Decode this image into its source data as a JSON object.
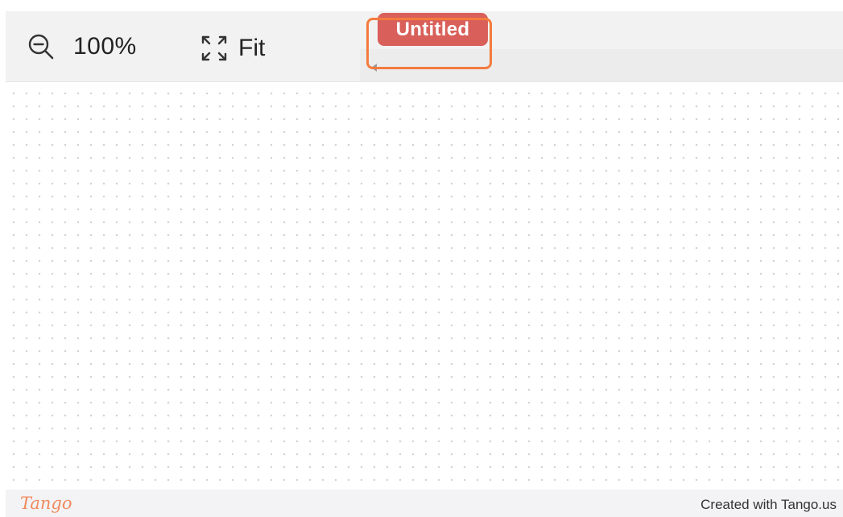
{
  "toolbar": {
    "zoom_label": "100%",
    "zoom_icon": "zoom-out-icon",
    "fit_label": "Fit",
    "fit_icon": "fit-expand-icon"
  },
  "document": {
    "title": "Untitled"
  },
  "footer": {
    "brand": "Tango",
    "credit": "Created with Tango.us"
  },
  "colors": {
    "title_chip": "#d9605a",
    "highlight": "#f47b3e",
    "brand": "#f08a5d",
    "toolbar_bg": "#f2f2f2"
  }
}
